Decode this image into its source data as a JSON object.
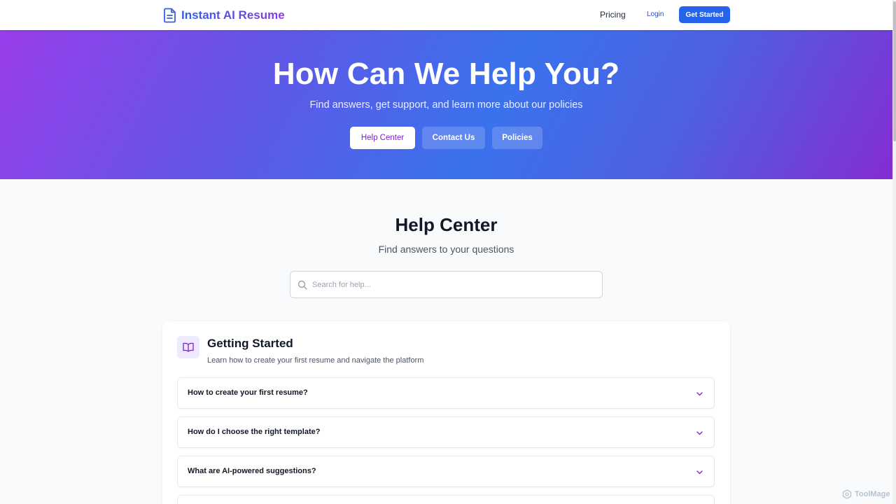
{
  "header": {
    "brand": "Instant AI Resume",
    "nav": {
      "pricing": "Pricing",
      "login": "Login",
      "cta": "Get Started"
    }
  },
  "hero": {
    "title": "How Can We Help You?",
    "subtitle": "Find answers, get support, and learn more about our policies",
    "tabs": {
      "help": "Help Center",
      "contact": "Contact Us",
      "policies": "Policies"
    },
    "active_tab": "Help Center"
  },
  "help_center": {
    "title": "Help Center",
    "subtitle": "Find answers to your questions",
    "search": {
      "placeholder": "Search for help...",
      "value": ""
    }
  },
  "category": {
    "icon": "book-open-icon",
    "title": "Getting Started",
    "description": "Learn how to create your first resume and navigate the platform",
    "faqs": [
      {
        "question": "How to create your first resume?"
      },
      {
        "question": "How do I choose the right template?"
      },
      {
        "question": "What are AI-powered suggestions?"
      },
      {
        "question": ""
      }
    ]
  },
  "watermark": "ToolMage",
  "colors": {
    "primary": "#2563eb",
    "accent_purple": "#7e22ce",
    "hero_gradient_start": "#9333ea",
    "hero_gradient_mid": "#2563eb"
  }
}
